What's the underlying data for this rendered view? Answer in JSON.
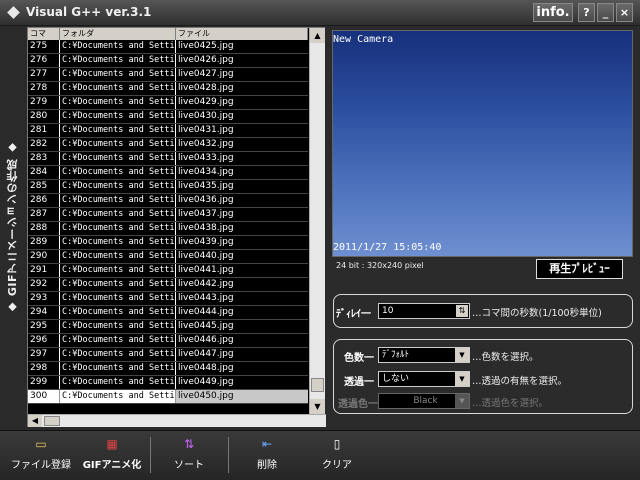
{
  "window": {
    "title": "Visual G++ ver.3.1",
    "info_label": "info.",
    "help_label": "?",
    "min_label": "_",
    "close_label": "×"
  },
  "side_tab": {
    "label": "◆ GIFアニメーションの作成 ◆"
  },
  "list": {
    "headers": [
      "コマNo.",
      "フォルダ",
      "ファイル"
    ],
    "rows": [
      {
        "no": "275",
        "folder": "C:¥Documents and Setti",
        "file": "live0425.jpg"
      },
      {
        "no": "276",
        "folder": "C:¥Documents and Setti",
        "file": "live0426.jpg"
      },
      {
        "no": "277",
        "folder": "C:¥Documents and Setti",
        "file": "live0427.jpg"
      },
      {
        "no": "278",
        "folder": "C:¥Documents and Setti",
        "file": "live0428.jpg"
      },
      {
        "no": "279",
        "folder": "C:¥Documents and Setti",
        "file": "live0429.jpg"
      },
      {
        "no": "280",
        "folder": "C:¥Documents and Setti",
        "file": "live0430.jpg"
      },
      {
        "no": "281",
        "folder": "C:¥Documents and Setti",
        "file": "live0431.jpg"
      },
      {
        "no": "282",
        "folder": "C:¥Documents and Setti",
        "file": "live0432.jpg"
      },
      {
        "no": "283",
        "folder": "C:¥Documents and Setti",
        "file": "live0433.jpg"
      },
      {
        "no": "284",
        "folder": "C:¥Documents and Setti",
        "file": "live0434.jpg"
      },
      {
        "no": "285",
        "folder": "C:¥Documents and Setti",
        "file": "live0435.jpg"
      },
      {
        "no": "286",
        "folder": "C:¥Documents and Setti",
        "file": "live0436.jpg"
      },
      {
        "no": "287",
        "folder": "C:¥Documents and Setti",
        "file": "live0437.jpg"
      },
      {
        "no": "288",
        "folder": "C:¥Documents and Setti",
        "file": "live0438.jpg"
      },
      {
        "no": "289",
        "folder": "C:¥Documents and Setti",
        "file": "live0439.jpg"
      },
      {
        "no": "290",
        "folder": "C:¥Documents and Setti",
        "file": "live0440.jpg"
      },
      {
        "no": "291",
        "folder": "C:¥Documents and Setti",
        "file": "live0441.jpg"
      },
      {
        "no": "292",
        "folder": "C:¥Documents and Setti",
        "file": "live0442.jpg"
      },
      {
        "no": "293",
        "folder": "C:¥Documents and Setti",
        "file": "live0443.jpg"
      },
      {
        "no": "294",
        "folder": "C:¥Documents and Setti",
        "file": "live0444.jpg"
      },
      {
        "no": "295",
        "folder": "C:¥Documents and Setti",
        "file": "live0445.jpg"
      },
      {
        "no": "296",
        "folder": "C:¥Documents and Setti",
        "file": "live0446.jpg"
      },
      {
        "no": "297",
        "folder": "C:¥Documents and Setti",
        "file": "live0447.jpg"
      },
      {
        "no": "298",
        "folder": "C:¥Documents and Setti",
        "file": "live0448.jpg"
      },
      {
        "no": "299",
        "folder": "C:¥Documents and Setti",
        "file": "live0449.jpg"
      },
      {
        "no": "300",
        "folder": "C:¥Documents and Setti",
        "file": "live0450.jpg",
        "selected": true
      }
    ]
  },
  "preview": {
    "camera_label": "New Camera",
    "timestamp": "2011/1/27 15:05:40",
    "info": "24 bit : 320x240 pixel",
    "preview_button": "再生ﾌﾟﾚﾋﾞｭｰ",
    "sky_color_top": "#16307c",
    "sky_color_bottom": "#6e8fd0"
  },
  "delay": {
    "label": "ﾃﾞｨﾚｲ一",
    "value": "10",
    "description": "…コマ間の秒数(1/100秒単位)"
  },
  "color_group": {
    "colors_label": "色数一",
    "colors_value": "ﾃﾞﾌｫﾙﾄ",
    "colors_desc": "…色数を選択。",
    "transparency_label": "透過一",
    "transparency_value": "しない",
    "transparency_desc": "…透過の有無を選択。",
    "trans_color_label": "透過色一",
    "trans_color_value": "Black",
    "trans_color_desc": "…透過色を選択。"
  },
  "toolbar": {
    "register": "ファイル登録",
    "gif": "GIFアニメ化",
    "sort": "ソート",
    "delete": "削除",
    "clear": "クリア"
  }
}
